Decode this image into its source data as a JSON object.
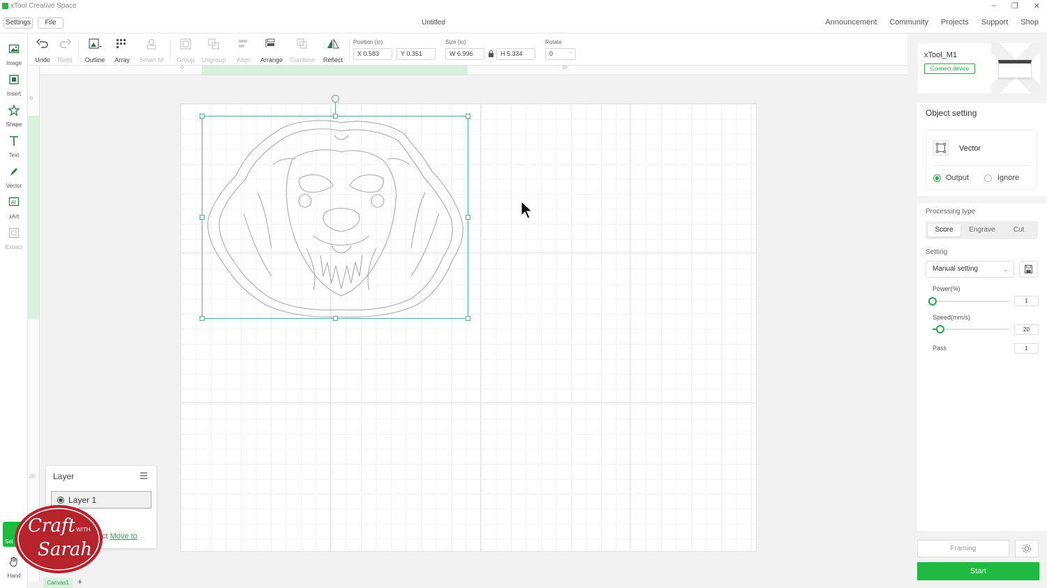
{
  "window": {
    "app_title": "xTool Creative Space",
    "controls": [
      "–",
      "❐",
      "✕"
    ]
  },
  "menubar": {
    "settings": "Settings",
    "file": "File",
    "doc_title": "Untitled",
    "links": [
      "Announcement",
      "Community",
      "Projects",
      "Support",
      "Shop"
    ]
  },
  "left_tools": [
    {
      "label": "Image",
      "icon": "image-icon"
    },
    {
      "label": "Insert",
      "icon": "insert-icon"
    },
    {
      "label": "Shape",
      "icon": "shape-icon"
    },
    {
      "label": "Text",
      "icon": "text-icon"
    },
    {
      "label": "Vector",
      "icon": "pen-icon"
    },
    {
      "label": "xArt",
      "icon": "ai-art-icon"
    },
    {
      "label": "Extract",
      "icon": "extract-icon"
    }
  ],
  "bottom_tools": {
    "select": "Sel",
    "hand": "Hand"
  },
  "toolbar": {
    "undo": "Undo",
    "redo": "Redo",
    "outline": "Outline",
    "array": "Array",
    "smart_fill": "Smart fill",
    "group": "Group",
    "ungroup": "Ungroup",
    "align": "Align",
    "arrange": "Arrange",
    "combine": "Combine",
    "reflect": "Reflect",
    "position_label": "Position (in)",
    "x_value": "X 0.583",
    "y_value": "Y 0.351",
    "size_label": "Size (in)",
    "w_value": "W 6.996",
    "h_value": "H 5.334",
    "rotate_label": "Rotate",
    "rotate_value": "0",
    "rotate_unit": "°"
  },
  "rulers": {
    "h_start": "0",
    "h_mid": "10",
    "v_start": "0",
    "v_end": "20"
  },
  "canvas_tabs": {
    "active": "Canvas1",
    "add": "+"
  },
  "layer_panel": {
    "title": "Layer",
    "layer_name": "Layer 1",
    "select_text": "ct",
    "move_to": "Move to"
  },
  "watermark": {
    "craft": "Craft",
    "with": "WITH",
    "sarah": "Sarah"
  },
  "device": {
    "name": "xTool_M1",
    "connect": "Connect device"
  },
  "object_setting": {
    "title": "Object setting",
    "type": "Vector",
    "output": "Output",
    "ignore": "Ignore",
    "output_selected": true,
    "processing_type_label": "Processing type",
    "processing_types": [
      "Score",
      "Engrave",
      "Cut"
    ],
    "processing_active": "Score",
    "setting_label": "Setting",
    "setting_value": "Manual setting",
    "power_label": "Power(%)",
    "power_value": "1",
    "power_fraction": 0.0,
    "speed_label": "Speed(mm/s)",
    "speed_value": "20",
    "speed_fraction": 0.1,
    "pass_label": "Pass",
    "pass_value": "1"
  },
  "actions": {
    "framing": "Framing",
    "start": "Start"
  },
  "colors": {
    "accent": "#1db940",
    "selection": "#5aa89a"
  }
}
